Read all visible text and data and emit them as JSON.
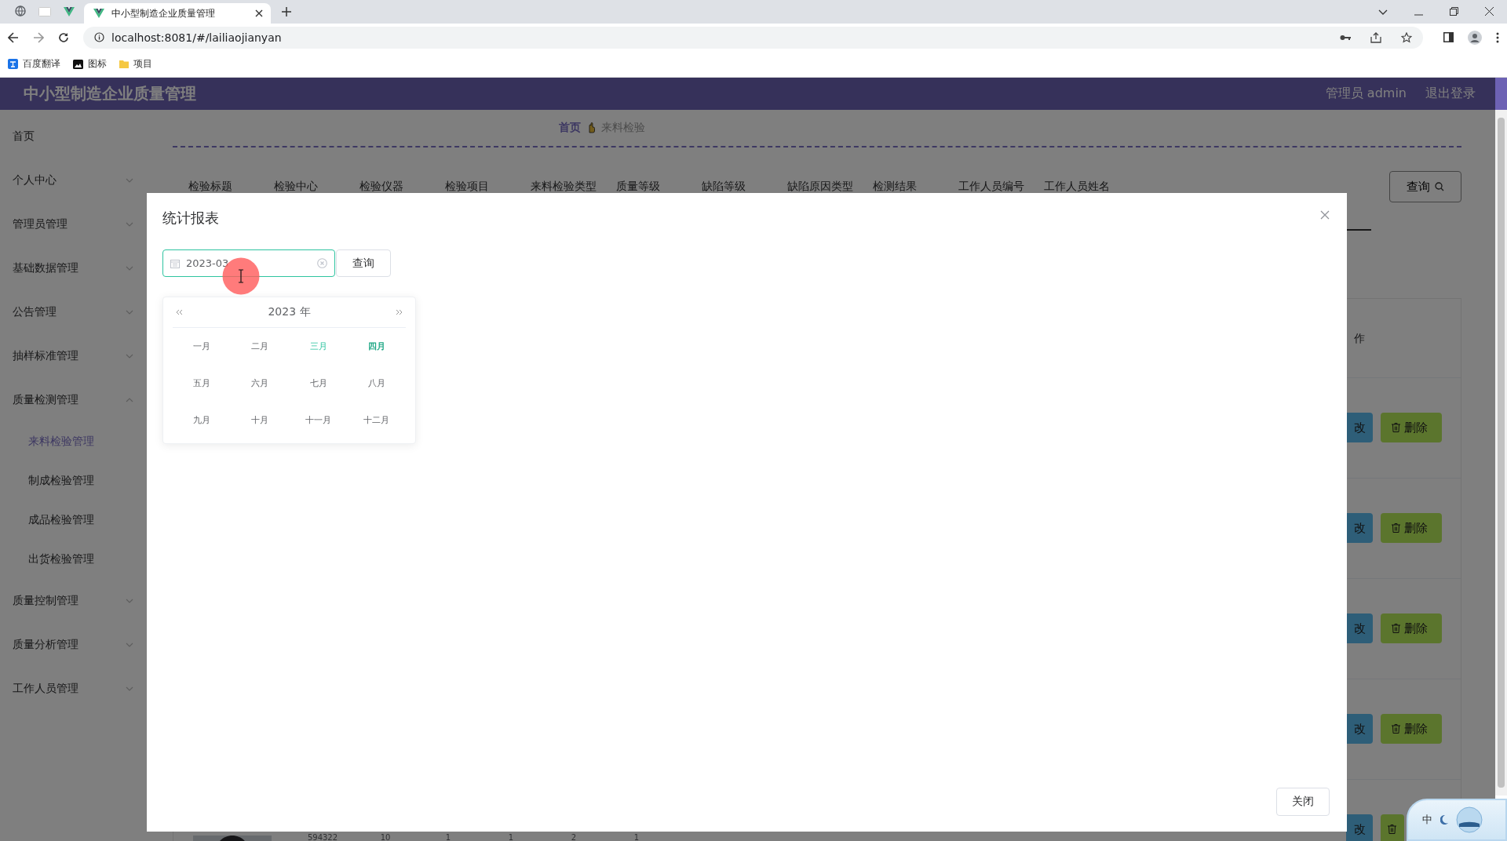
{
  "browser": {
    "tabs": [
      {
        "title": "中小型制造企业质量管理",
        "selected": true
      }
    ],
    "url": "localhost:8081/#/lailiaojianyan",
    "bookmarks": [
      {
        "label": "百度翻译",
        "kind": "translator"
      },
      {
        "label": "图标",
        "kind": "site"
      },
      {
        "label": "项目",
        "kind": "folder"
      }
    ]
  },
  "header": {
    "title": "中小型制造企业质量管理",
    "user": "管理员 admin",
    "logout": "退出登录"
  },
  "sidebar": {
    "items": [
      {
        "label": "首页",
        "kind": "link"
      },
      {
        "label": "个人中心",
        "kind": "submenu",
        "expanded": false
      },
      {
        "label": "管理员管理",
        "kind": "submenu",
        "expanded": false
      },
      {
        "label": "基础数据管理",
        "kind": "submenu",
        "expanded": false
      },
      {
        "label": "公告管理",
        "kind": "submenu",
        "expanded": false
      },
      {
        "label": "抽样标准管理",
        "kind": "submenu",
        "expanded": false
      },
      {
        "label": "质量检测管理",
        "kind": "submenu",
        "expanded": true,
        "children": [
          {
            "label": "来料检验管理",
            "selected": true
          },
          {
            "label": "制成检验管理",
            "selected": false
          },
          {
            "label": "成品检验管理",
            "selected": false
          },
          {
            "label": "出货检验管理",
            "selected": false
          }
        ]
      },
      {
        "label": "质量控制管理",
        "kind": "submenu",
        "expanded": false
      },
      {
        "label": "质量分析管理",
        "kind": "submenu",
        "expanded": false
      },
      {
        "label": "工作人员管理",
        "kind": "submenu",
        "expanded": false
      }
    ]
  },
  "breadcrumb": [
    {
      "label": "首页",
      "current": false
    },
    {
      "label": "来料检验",
      "current": true
    }
  ],
  "filters": {
    "labels": [
      "检验标题",
      "检验中心",
      "检验仪器",
      "检验项目",
      "来料检验类型",
      "质量等级",
      "缺陷等级",
      "缺陷原因类型",
      "检测结果",
      "工作人员编号",
      "工作人员姓名"
    ],
    "query_button": "查询"
  },
  "table": {
    "action_header": "作",
    "rows": [
      {
        "edit": "改",
        "delete": "删除"
      },
      {
        "edit": "改",
        "delete": "删除"
      },
      {
        "edit": "改",
        "delete": "删除"
      },
      {
        "edit": "改",
        "delete": "删除"
      },
      {
        "kind": "picture",
        "cells": [
          "594322",
          "10",
          "1",
          "1",
          "2",
          "1"
        ],
        "edit": "改"
      }
    ]
  },
  "dialog": {
    "title": "统计报表",
    "month_field": {
      "value": "2023-03",
      "focused": true
    },
    "query_button": "查询",
    "picker": {
      "year": "2023 年",
      "months": [
        {
          "label": "一月",
          "selected": false,
          "current": false
        },
        {
          "label": "二月",
          "selected": false,
          "current": false
        },
        {
          "label": "三月",
          "selected": true,
          "current": false
        },
        {
          "label": "四月",
          "selected": false,
          "current": true
        },
        {
          "label": "五月",
          "selected": false,
          "current": false
        },
        {
          "label": "六月",
          "selected": false,
          "current": false
        },
        {
          "label": "七月",
          "selected": false,
          "current": false
        },
        {
          "label": "八月",
          "selected": false,
          "current": false
        },
        {
          "label": "九月",
          "selected": false,
          "current": false
        },
        {
          "label": "十月",
          "selected": false,
          "current": false
        },
        {
          "label": "十一月",
          "selected": false,
          "current": false
        },
        {
          "label": "十二月",
          "selected": false,
          "current": false
        }
      ]
    },
    "close_button": "关闭"
  },
  "ime_widget": {
    "label": "中"
  }
}
